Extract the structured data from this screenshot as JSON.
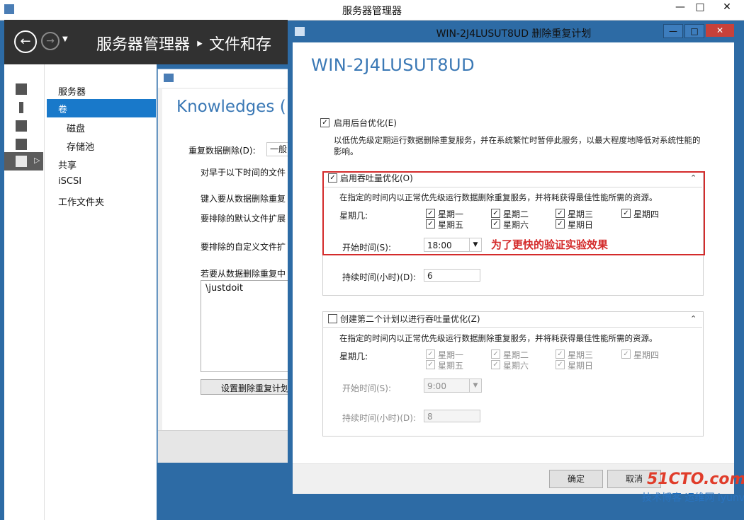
{
  "main_window": {
    "title": "服务器管理器",
    "controls": [
      "—",
      "□",
      "✕"
    ],
    "breadcrumb": "服务器管理器 ‣ 文件和存",
    "nav_items": [
      "服务器",
      "卷",
      "磁盘",
      "存储池",
      "共享",
      "iSCSI",
      "工作文件夹"
    ]
  },
  "bg_dialog": {
    "title": "Knowledges (F",
    "dedup_label": "重复数据删除(D):",
    "dedup_value": "一般",
    "line1": "对早于以下时间的文件",
    "line2": "键入要从数据删除重复",
    "line3": "要排除的默认文件扩展",
    "line4": "要排除的自定义文件扩",
    "line5": "若要从数据删除重复中",
    "excluded_folder": "\\justdoit",
    "schedule_button": "设置删除重复计划"
  },
  "dialog": {
    "title": "WIN-2J4LUSUT8UD 删除重复计划",
    "heading": "WIN-2J4LUSUT8UD",
    "bg_opt_label": "启用后台优化(E)",
    "bg_opt_desc": "以低优先级定期运行数据删除重复服务，并在系统繁忙时暂停此服务，以最大程度地降低对系统性能的影响。",
    "schedule1": {
      "label": "启用吞吐量优化(O)",
      "desc": "在指定的时间内以正常优先级运行数据删除重复服务，并将耗获得最佳性能所需的资源。",
      "weekday_label": "星期几:",
      "days": [
        "星期一",
        "星期二",
        "星期三",
        "星期四",
        "星期五",
        "星期六",
        "星期日"
      ],
      "start_label": "开始时间(S):",
      "start_value": "18:00",
      "duration_label": "持续时间(小时)(D):",
      "duration_value": "6"
    },
    "schedule2": {
      "label": "创建第二个计划以进行吞吐量优化(Z)",
      "desc": "在指定的时间内以正常优先级运行数据删除重复服务，并将耗获得最佳性能所需的资源。",
      "weekday_label": "星期几:",
      "days": [
        "星期一",
        "星期二",
        "星期三",
        "星期四",
        "星期五",
        "星期六",
        "星期日"
      ],
      "start_label": "开始时间(S):",
      "start_value": "9:00",
      "duration_label": "持续时间(小时)(D):",
      "duration_value": "8"
    },
    "annotation": "为了更快的验证实验效果",
    "ok_label": "确定",
    "cancel_label": "取消"
  },
  "watermark": {
    "line1": "51CTO.com",
    "line2": "技术博客 运维网 iyunv.com"
  }
}
